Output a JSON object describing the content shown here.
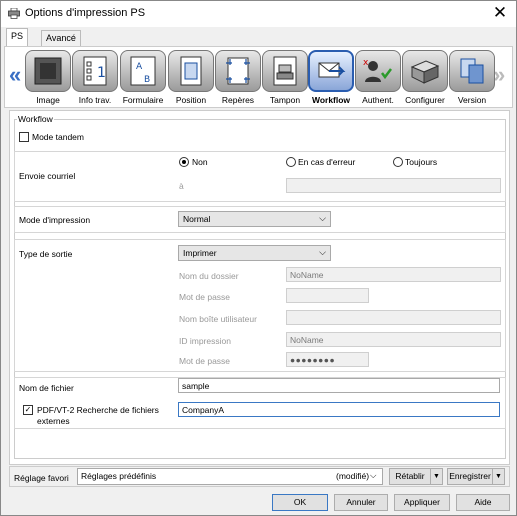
{
  "window": {
    "title": "Options d'impression PS"
  },
  "tabs": [
    {
      "label": "PS"
    },
    {
      "label": "Avancé"
    }
  ],
  "toolbar": {
    "items": [
      {
        "label": "Image",
        "icon": "image-icon"
      },
      {
        "label": "Info trav.",
        "icon": "job-info-icon"
      },
      {
        "label": "Formulaire",
        "icon": "form-icon"
      },
      {
        "label": "Position",
        "icon": "position-icon"
      },
      {
        "label": "Repères",
        "icon": "marks-icon"
      },
      {
        "label": "Tampon",
        "icon": "stamp-icon"
      },
      {
        "label": "Workflow",
        "icon": "workflow-icon",
        "selected": true
      },
      {
        "label": "Authent.",
        "icon": "authentication-icon"
      },
      {
        "label": "Configurer",
        "icon": "configure-icon"
      },
      {
        "label": "Version",
        "icon": "version-icon"
      }
    ]
  },
  "workflow": {
    "group_label": "Workflow",
    "tandem_label": "Mode tandem",
    "email": {
      "label": "Envoie courriel",
      "options": [
        "Non",
        "En cas d'erreur",
        "Toujours"
      ],
      "selected": "Non",
      "to_label": "à",
      "to_value": ""
    },
    "print_mode": {
      "label": "Mode d'impression",
      "value": "Normal"
    },
    "output": {
      "label": "Type de sortie",
      "value": "Imprimer",
      "folder_name_label": "Nom du dossier",
      "folder_name_value": "NoName",
      "password_label": "Mot de passe",
      "user_box_label": "Nom boîte utilisateur",
      "print_id_label": "ID impression",
      "print_id_value": "NoName",
      "password2_label": "Mot de passe",
      "password2_value": "●●●●●●●●"
    },
    "filename": {
      "label": "Nom de fichier",
      "value": "sample"
    },
    "pdf_vt": {
      "label_line1": "PDF/VT-2 Recherche de fichiers",
      "label_line2": "externes",
      "checked": true,
      "value": "CompanyA"
    }
  },
  "footer": {
    "favorite_label": "Réglage favori",
    "favorite_value": "Réglages prédéfinis",
    "favorite_modified": "(modifié)",
    "restore_label": "Rétablir",
    "save_label": "Enregistrer",
    "ok_label": "OK",
    "cancel_label": "Annuler",
    "apply_label": "Appliquer",
    "help_label": "Aide"
  }
}
